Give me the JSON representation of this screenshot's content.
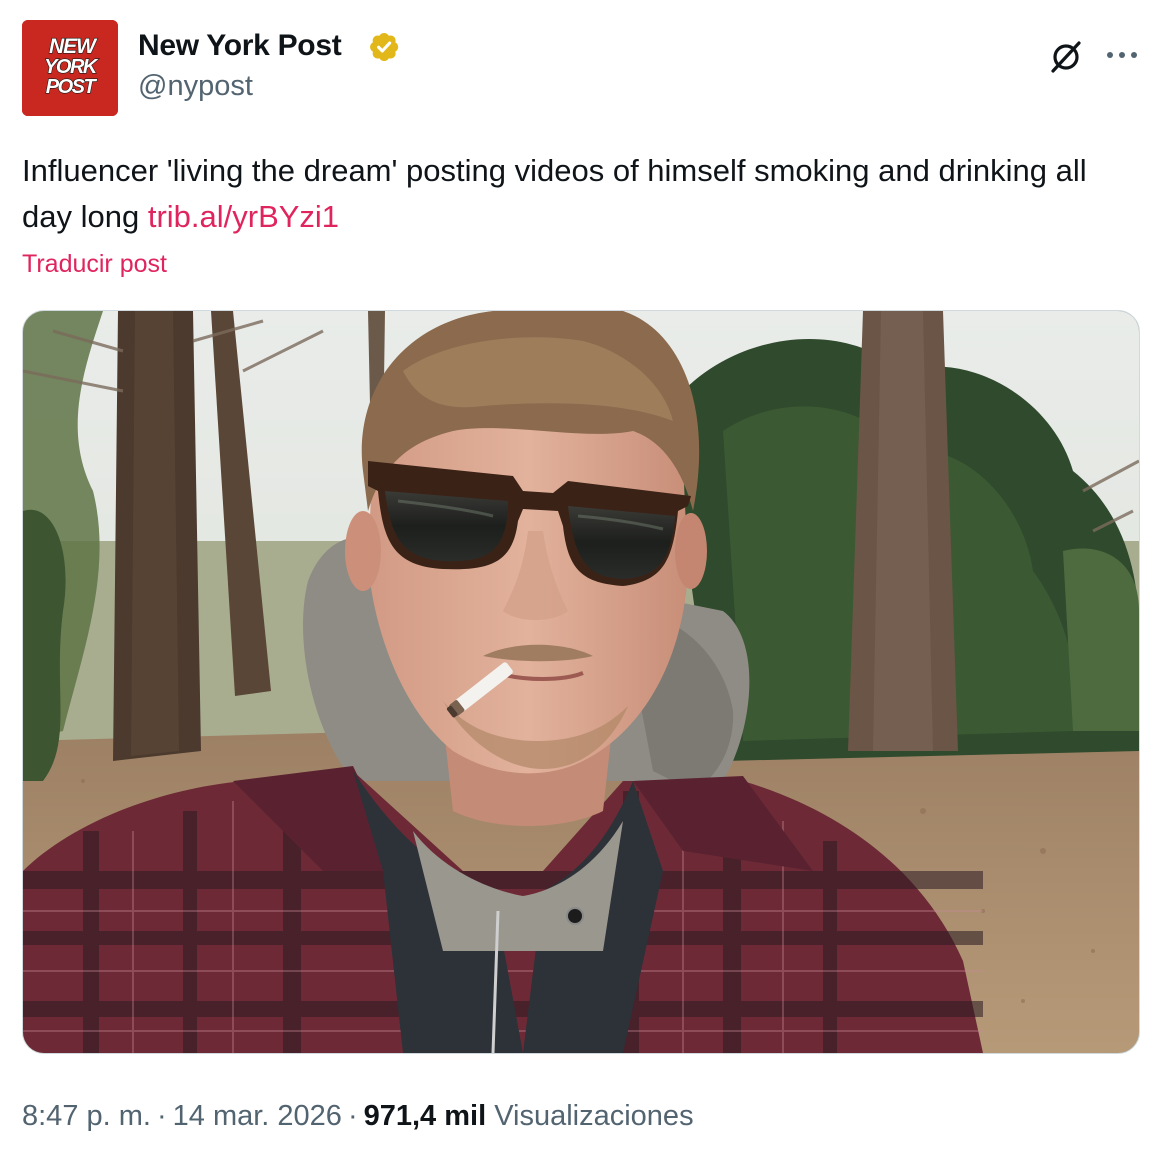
{
  "author": {
    "display_name": "New York Post",
    "handle": "@nypost",
    "verified": true,
    "avatar_logo_text": "NEW YORK POST",
    "brand_color": "#c8281f"
  },
  "actions": {
    "grok_icon": "grok-icon",
    "more_icon": "more-icon"
  },
  "post": {
    "text": "Influencer 'living the dream' posting videos of himself smoking and drinking all day long ",
    "link_text": "trib.al/yrBYzi1",
    "translate_label": "Traducir post",
    "accent_color": "#e0245e"
  },
  "meta": {
    "time": "8:47 p. m.",
    "separator": "·",
    "date": "14 mar. 2026",
    "views_count": "971,4 mil",
    "views_label": "Visualizaciones"
  }
}
